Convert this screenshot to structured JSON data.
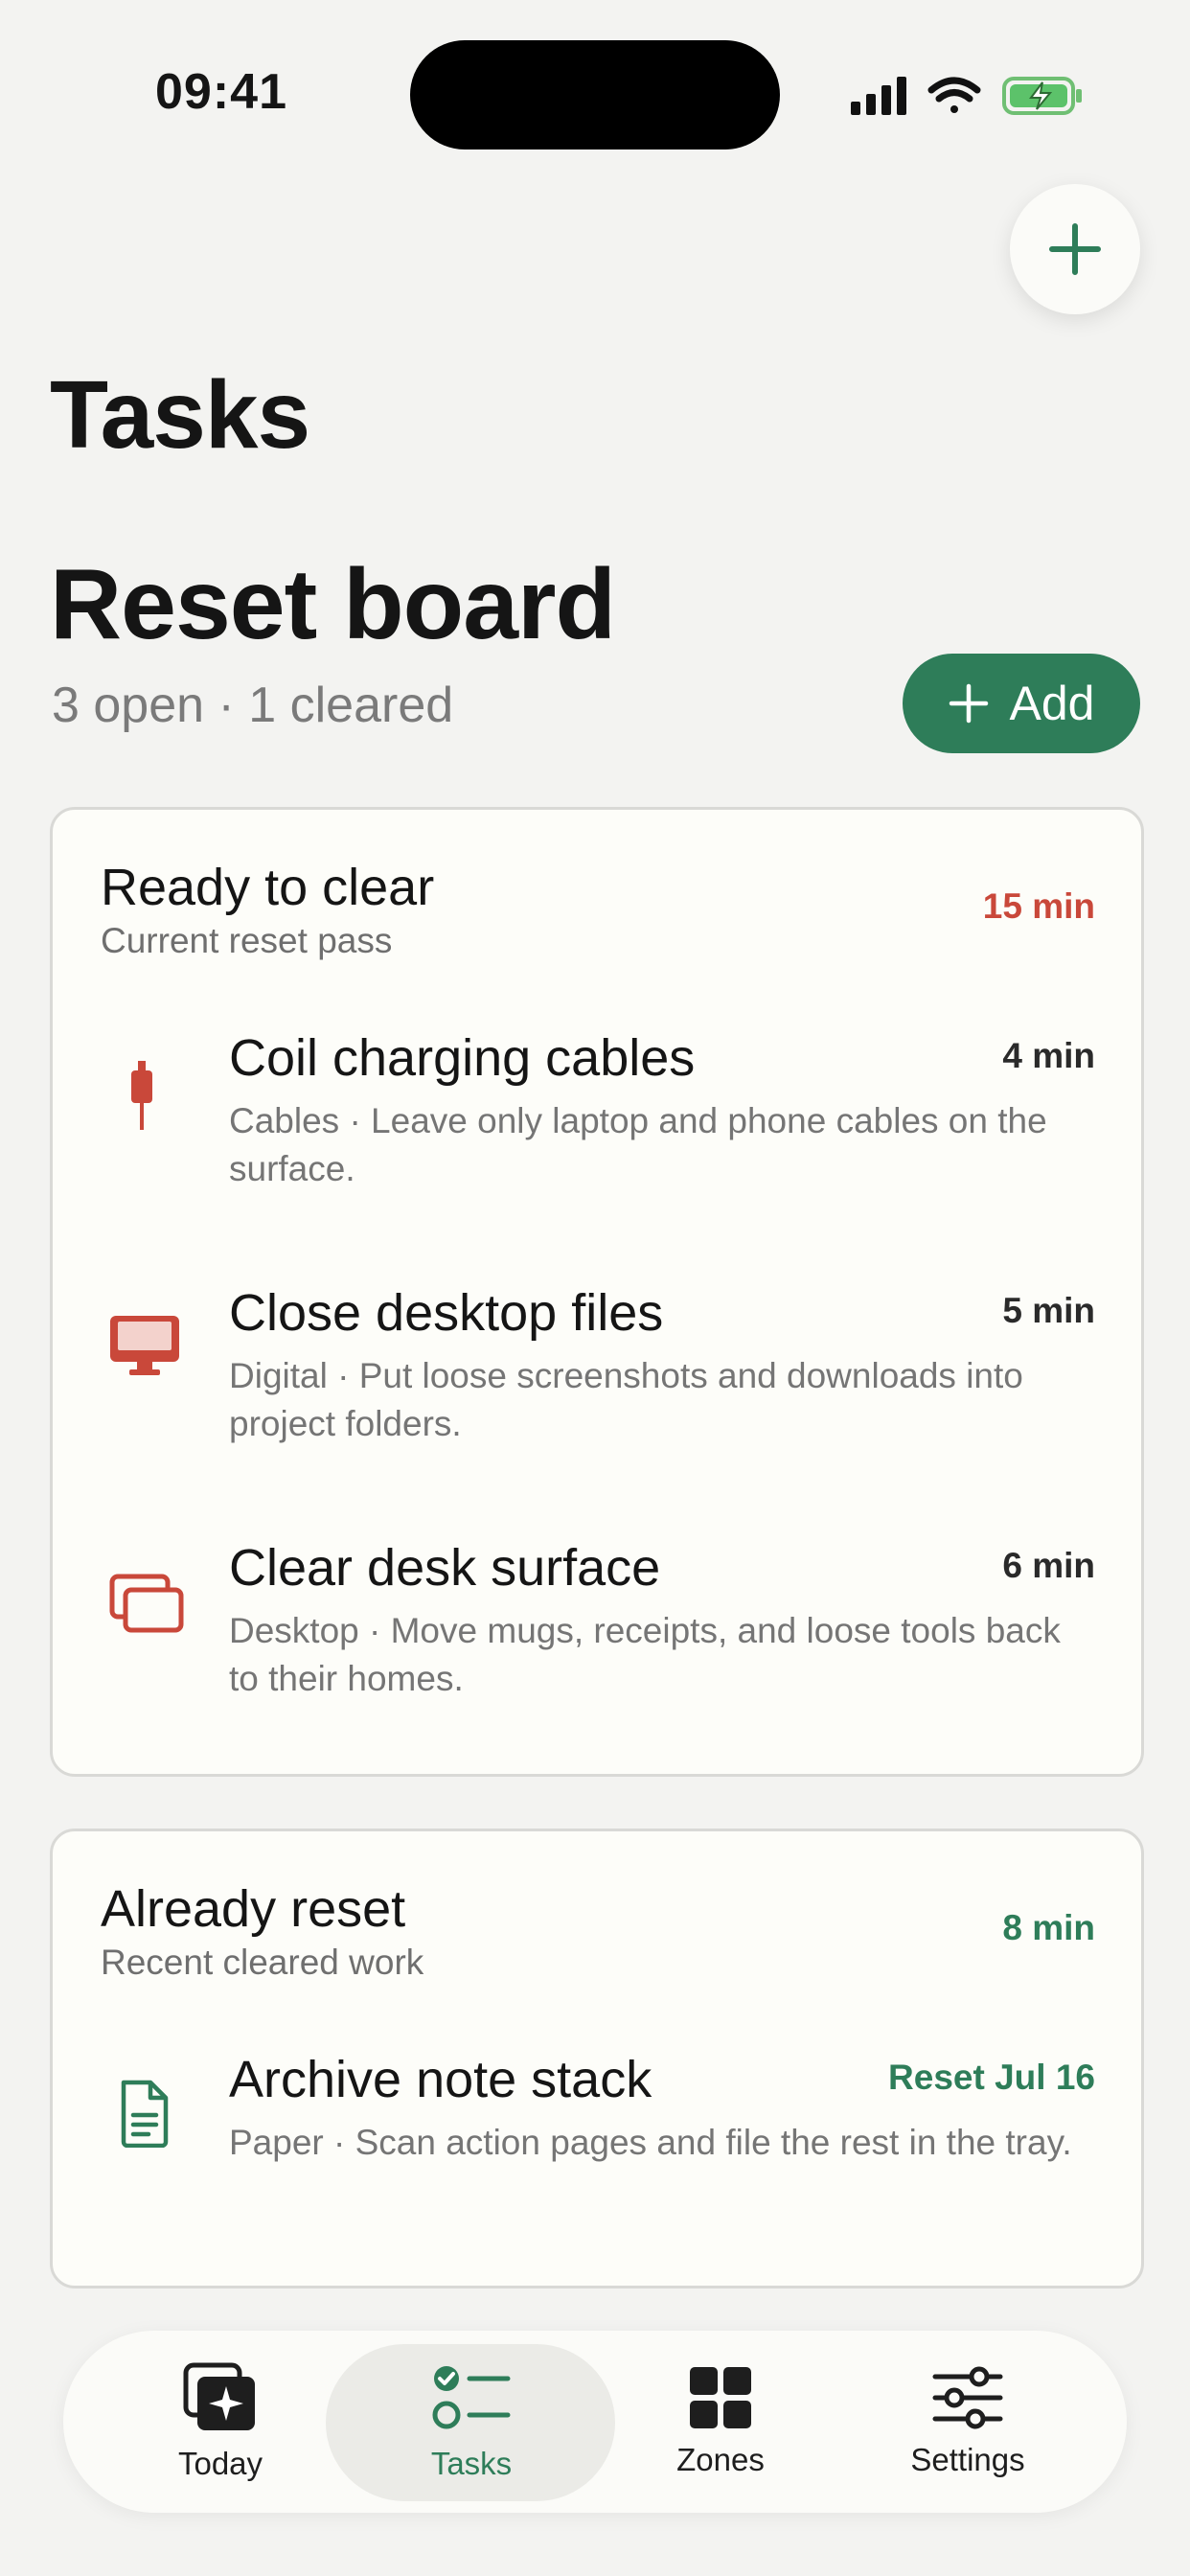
{
  "status": {
    "time": "09:41"
  },
  "header": {
    "title": "Tasks"
  },
  "board": {
    "title": "Reset board",
    "meta": "3 open · 1 cleared",
    "add_label": "Add"
  },
  "sections": [
    {
      "title": "Ready to clear",
      "subtitle": "Current reset pass",
      "total": "15 min",
      "total_color": "#c9483a",
      "items": [
        {
          "title": "Coil charging cables",
          "desc": "Cables · Leave only laptop and phone cables on the surface.",
          "duration": "4 min",
          "icon": "cable-icon"
        },
        {
          "title": "Close desktop files",
          "desc": "Digital · Put loose screenshots and downloads into project folders.",
          "duration": "5 min",
          "icon": "monitor-icon"
        },
        {
          "title": "Clear desk surface",
          "desc": "Desktop · Move mugs, receipts, and loose tools back to their homes.",
          "duration": "6 min",
          "icon": "stacked-windows-icon"
        }
      ]
    },
    {
      "title": "Already reset",
      "subtitle": "Recent cleared work",
      "total": "8 min",
      "total_color": "#2e7d59",
      "items": [
        {
          "title": "Archive note stack",
          "desc": "Paper · Scan action pages and file the rest in the tray.",
          "duration": "Reset Jul 16",
          "icon": "document-icon"
        }
      ]
    }
  ],
  "tabs": [
    {
      "label": "Today",
      "icon": "sparkle-window-icon"
    },
    {
      "label": "Tasks",
      "icon": "checklist-icon",
      "active": true
    },
    {
      "label": "Zones",
      "icon": "grid-icon"
    },
    {
      "label": "Settings",
      "icon": "sliders-icon"
    }
  ],
  "colors": {
    "accent": "#2e7d59",
    "alert": "#c9483a",
    "background": "#f3f3f1",
    "card": "#fdfdf9"
  }
}
